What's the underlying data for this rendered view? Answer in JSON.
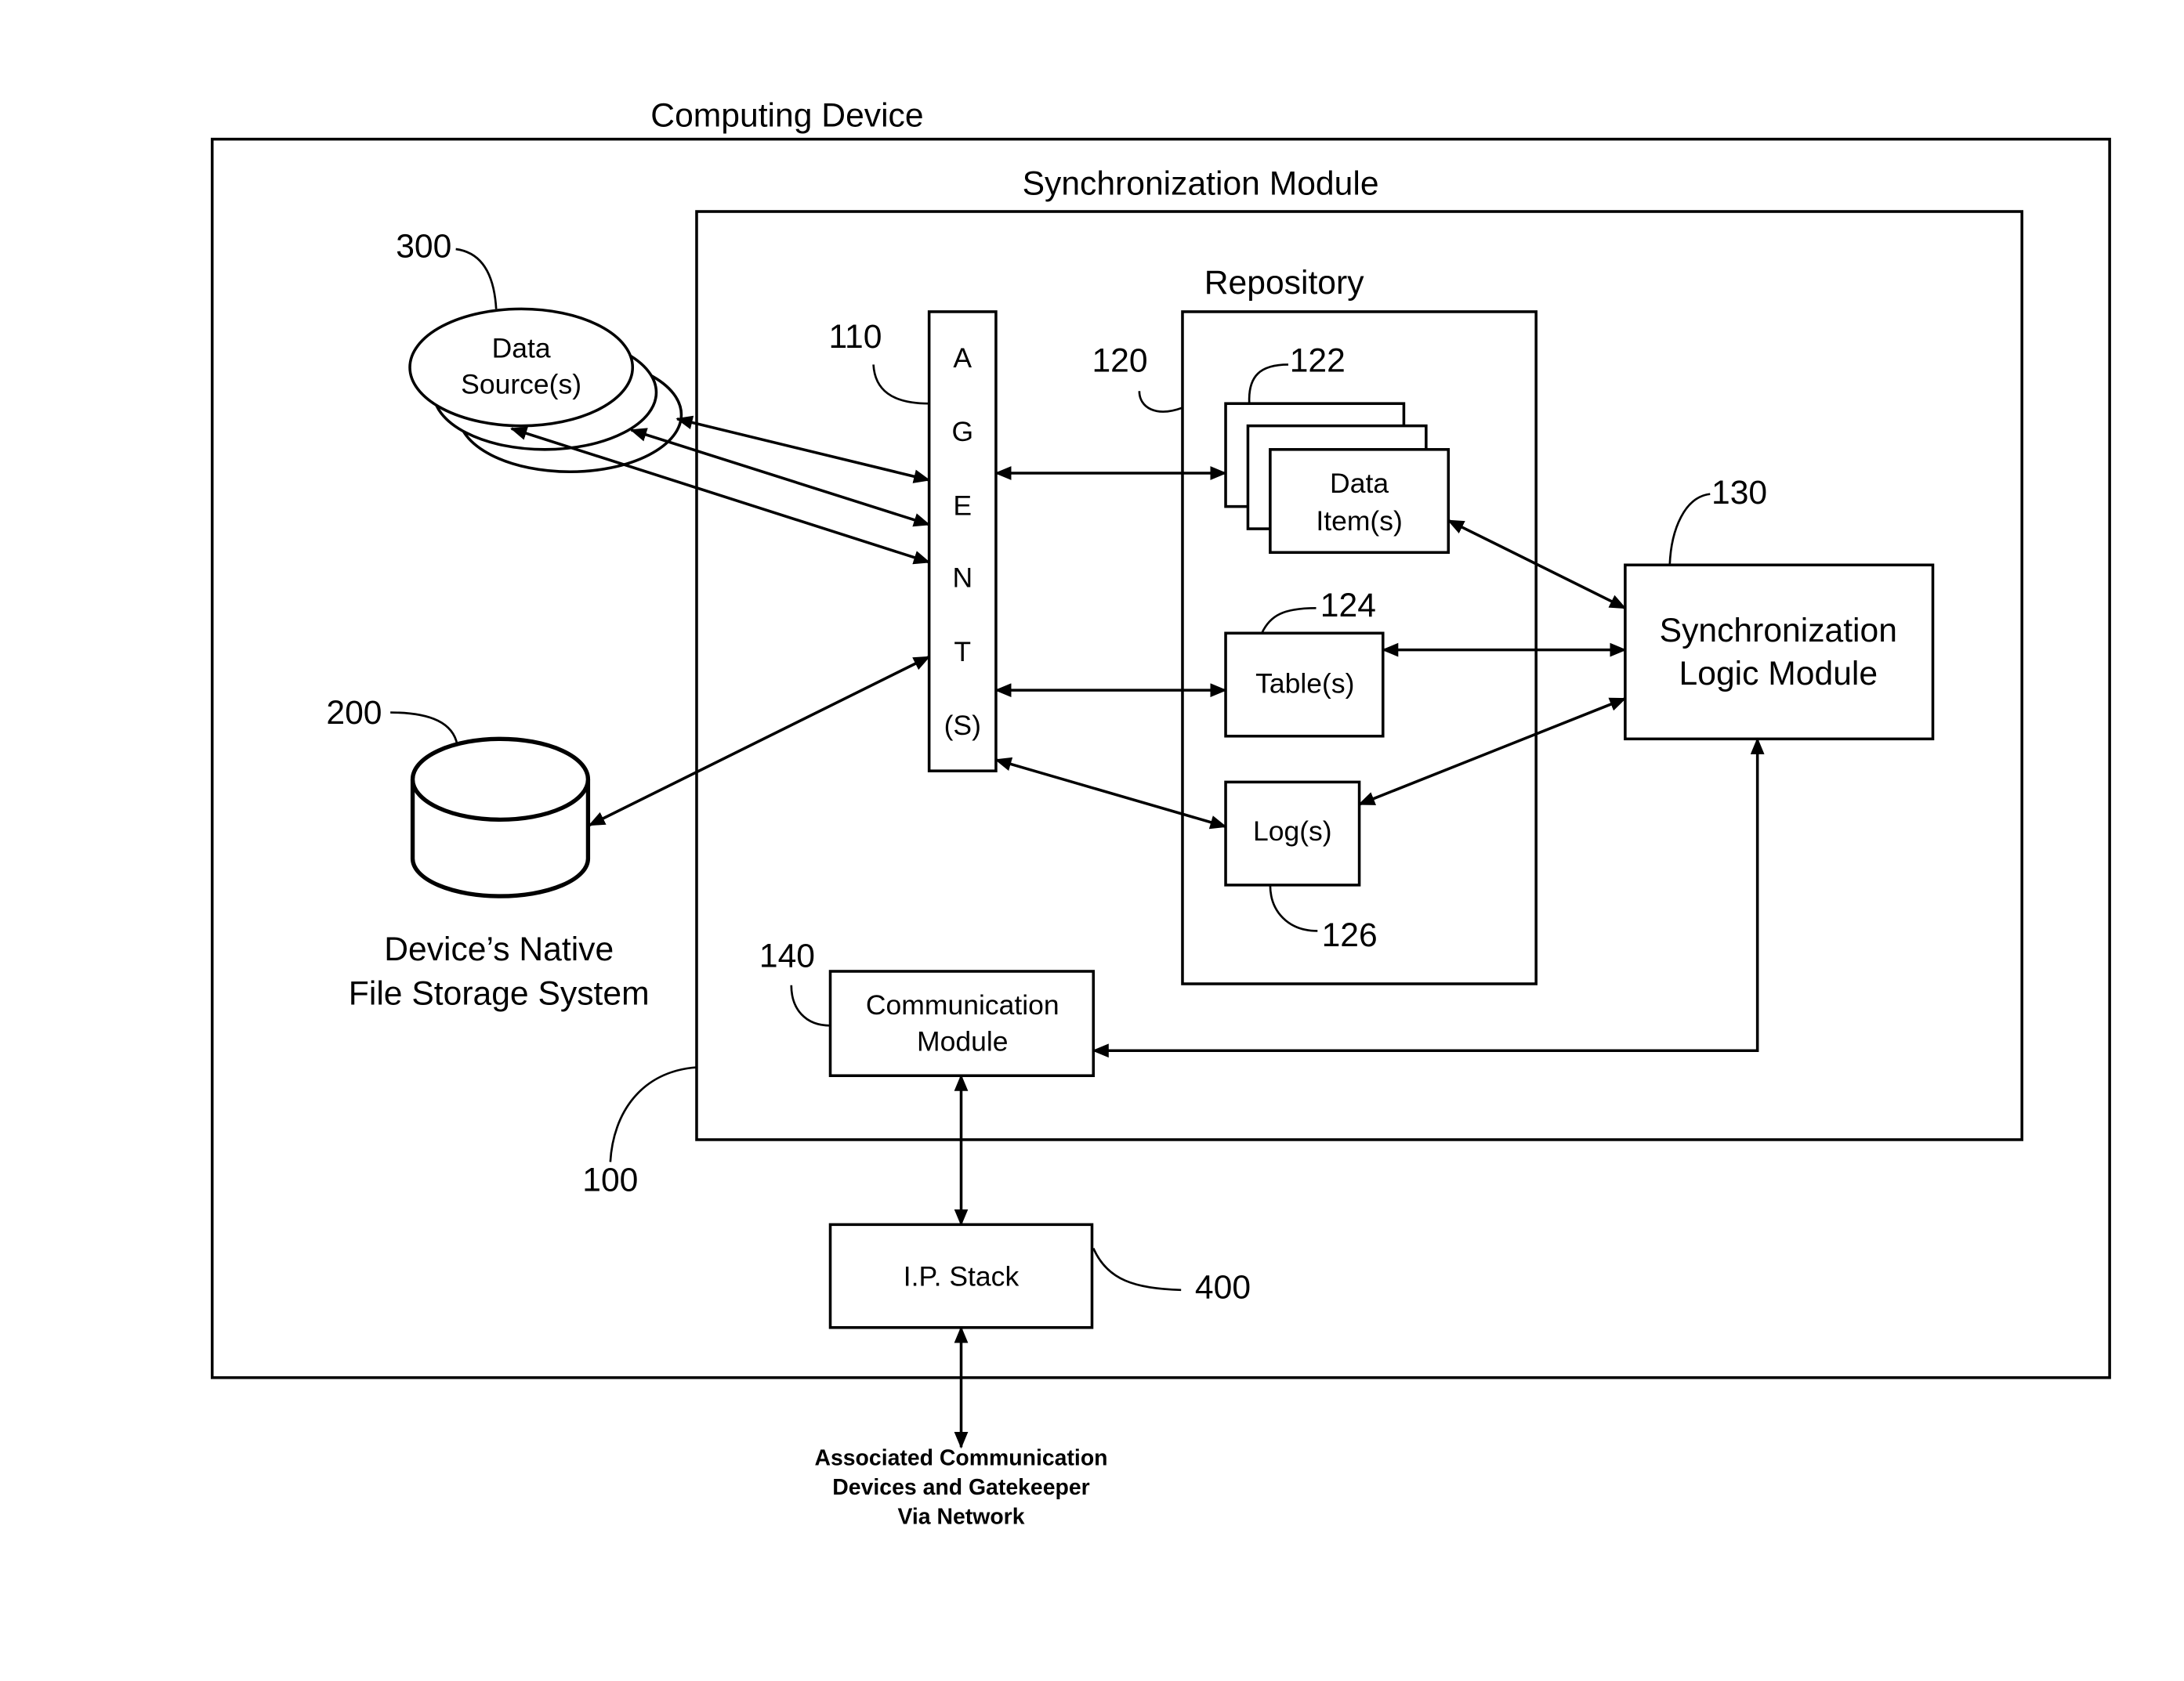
{
  "figure": {
    "computing_device": {
      "title": "Computing Device",
      "ref": "100"
    },
    "sync_module": {
      "title": "Synchronization Module"
    },
    "data_sources": {
      "label_line1": "Data",
      "label_line2": "Source(s)",
      "ref": "300"
    },
    "file_storage": {
      "label_line1": "Device’s Native",
      "label_line2": "File Storage System",
      "ref": "200"
    },
    "agents": {
      "letters": [
        "A",
        "G",
        "E",
        "N",
        "T",
        "(S)"
      ],
      "ref": "110"
    },
    "repository": {
      "title": "Repository",
      "ref": "120"
    },
    "data_items": {
      "label_line1": "Data",
      "label_line2": "Item(s)",
      "ref": "122"
    },
    "tables": {
      "label": "Table(s)",
      "ref": "124"
    },
    "logs": {
      "label": "Log(s)",
      "ref": "126"
    },
    "sync_logic": {
      "label_line1": "Synchronization",
      "label_line2": "Logic Module",
      "ref": "130"
    },
    "comm_module": {
      "label_line1": "Communication",
      "label_line2": "Module",
      "ref": "140"
    },
    "ip_stack": {
      "label": "I.P. Stack",
      "ref": "400"
    },
    "network_note": {
      "line1": "Associated Communication",
      "line2": "Devices and Gatekeeper",
      "line3": "Via Network"
    }
  }
}
